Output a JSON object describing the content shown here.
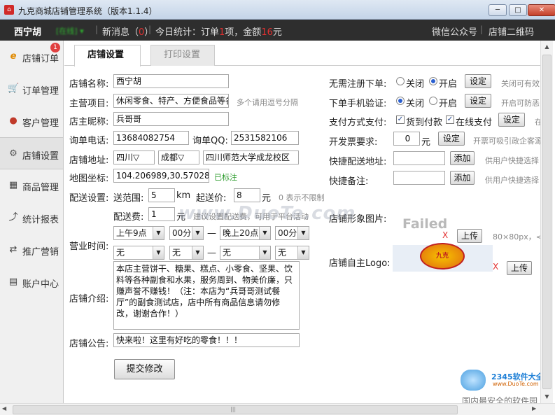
{
  "window": {
    "title": "九克商城店铺管理系统（版本1.1.4）",
    "minimize": "─",
    "maximize": "□",
    "close": "✕"
  },
  "header": {
    "shop_name": "西宁胡",
    "online": "[在线] ▾",
    "news_prefix": "新消息（",
    "news_count": "0",
    "news_suffix": "）",
    "stats_prefix": "今日统计：订单",
    "stats_orders": "1",
    "stats_mid": "项，金额",
    "stats_amount": "16",
    "stats_suffix": "元",
    "wechat": "微信公众号",
    "shop_qr": "店铺二维码",
    "sep": "|"
  },
  "sidebar": {
    "items": [
      {
        "label": "店铺订单",
        "icon": "e",
        "badge": "1"
      },
      {
        "label": "订单管理",
        "icon": "🛒"
      },
      {
        "label": "客户管理",
        "icon": "●"
      },
      {
        "label": "店铺设置",
        "icon": "⚙"
      },
      {
        "label": "商品管理",
        "icon": "▦"
      },
      {
        "label": "统计报表",
        "icon": "⤴"
      },
      {
        "label": "推广营销",
        "icon": "⇄"
      },
      {
        "label": "账户中心",
        "icon": "▤"
      }
    ]
  },
  "tabs": [
    {
      "label": "店铺设置",
      "active": true
    },
    {
      "label": "打印设置",
      "active": false
    }
  ],
  "form": {
    "shop_name_label": "店铺名称:",
    "shop_name": "西宁胡",
    "main_items_label": "主营项目:",
    "main_items": "休闲零食、特产、方便食品等各",
    "main_items_hint": "多个请用逗号分隔",
    "owner_label": "店主昵称:",
    "owner": "兵哥哥",
    "phone_label": "询单电话:",
    "phone": "13684082754",
    "qq_label": "询单QQ:",
    "qq": "2531582106",
    "address_label": "店铺地址:",
    "province": "四川▽",
    "city": "成都▽",
    "address": "四川师范大学成龙校区",
    "coords_label": "地图坐标:",
    "coords": "104.206989,30.570282",
    "coords_status": "已标注",
    "delivery_label": "配送设置:",
    "range_label": "送范围:",
    "range": "5",
    "range_unit": "km",
    "min_price_label": "起送价:",
    "min_price": "8",
    "min_price_unit": "元",
    "min_price_hint": "0 表示不限制",
    "fee_label": "配送费:",
    "fee": "1",
    "fee_unit": "元",
    "fee_hint": "建议设置配送费，可用于平台活动",
    "hours_label": "营业时间:",
    "dash": "—",
    "open1_h": "上午9点",
    "open1_m": "00分",
    "close1_h": "晚上20点",
    "close1_m": "00分",
    "open2_h": "无",
    "open2_m": "无",
    "close2_h": "无",
    "close2_m": "无",
    "intro_label": "店铺介绍:",
    "intro": "本店主营饼干、糖果、糕点、小零食、坚果、饮料等各种副食和水果，服务周到、物美价廉，只赚声誉不赚钱！（注：本店为“兵哥哥测试餐厅”的副食测试店，店中所有商品信息请勿修改，谢谢合作！）",
    "notice_label": "店铺公告:",
    "notice": "快来啦！这里有好吃的零食！！！",
    "submit": "提交修改"
  },
  "right": {
    "no_register_label": "无需注册下单:",
    "off": "关闭",
    "on": "开启",
    "set": "设定",
    "no_register_hint": "关闭可有效",
    "phone_verify_label": "下单手机验证:",
    "phone_verify_hint": "开启可防恶",
    "pay_label": "支付方式支付:",
    "cod": "货到付款",
    "online_pay": "在线支付",
    "pay_more": "在",
    "invoice_label": "开发票要求:",
    "invoice_value": "0",
    "invoice_unit": "元",
    "invoice_hint": "开票可吸引政企客源",
    "quick_addr_label": "快捷配送地址:",
    "add": "添加",
    "quick_addr_hint": "供用户快捷选择",
    "quick_note_label": "快捷备注:",
    "quick_note_hint": "供用户快捷选择",
    "image_label": "店铺形象图片:",
    "image_failed": "Failed",
    "x": "X",
    "upload": "上传",
    "image_size": "80×80px，<2",
    "logo_label": "店铺自主Logo:",
    "logo_text": "九克"
  },
  "watermark": {
    "site": "www.DuoTe.com",
    "brand": "2345软件大全",
    "brand_url": "www.DuoTe.com",
    "slogan": "国内最安全的软件园"
  },
  "scroll": {
    "up": "▲",
    "down": "▼",
    "left": "◀",
    "right": "▶",
    "grip": "|||"
  },
  "colors": {
    "accent_red": "#e23030",
    "header_bg": "#2e2e2e",
    "online_green": "#2fb52f"
  }
}
